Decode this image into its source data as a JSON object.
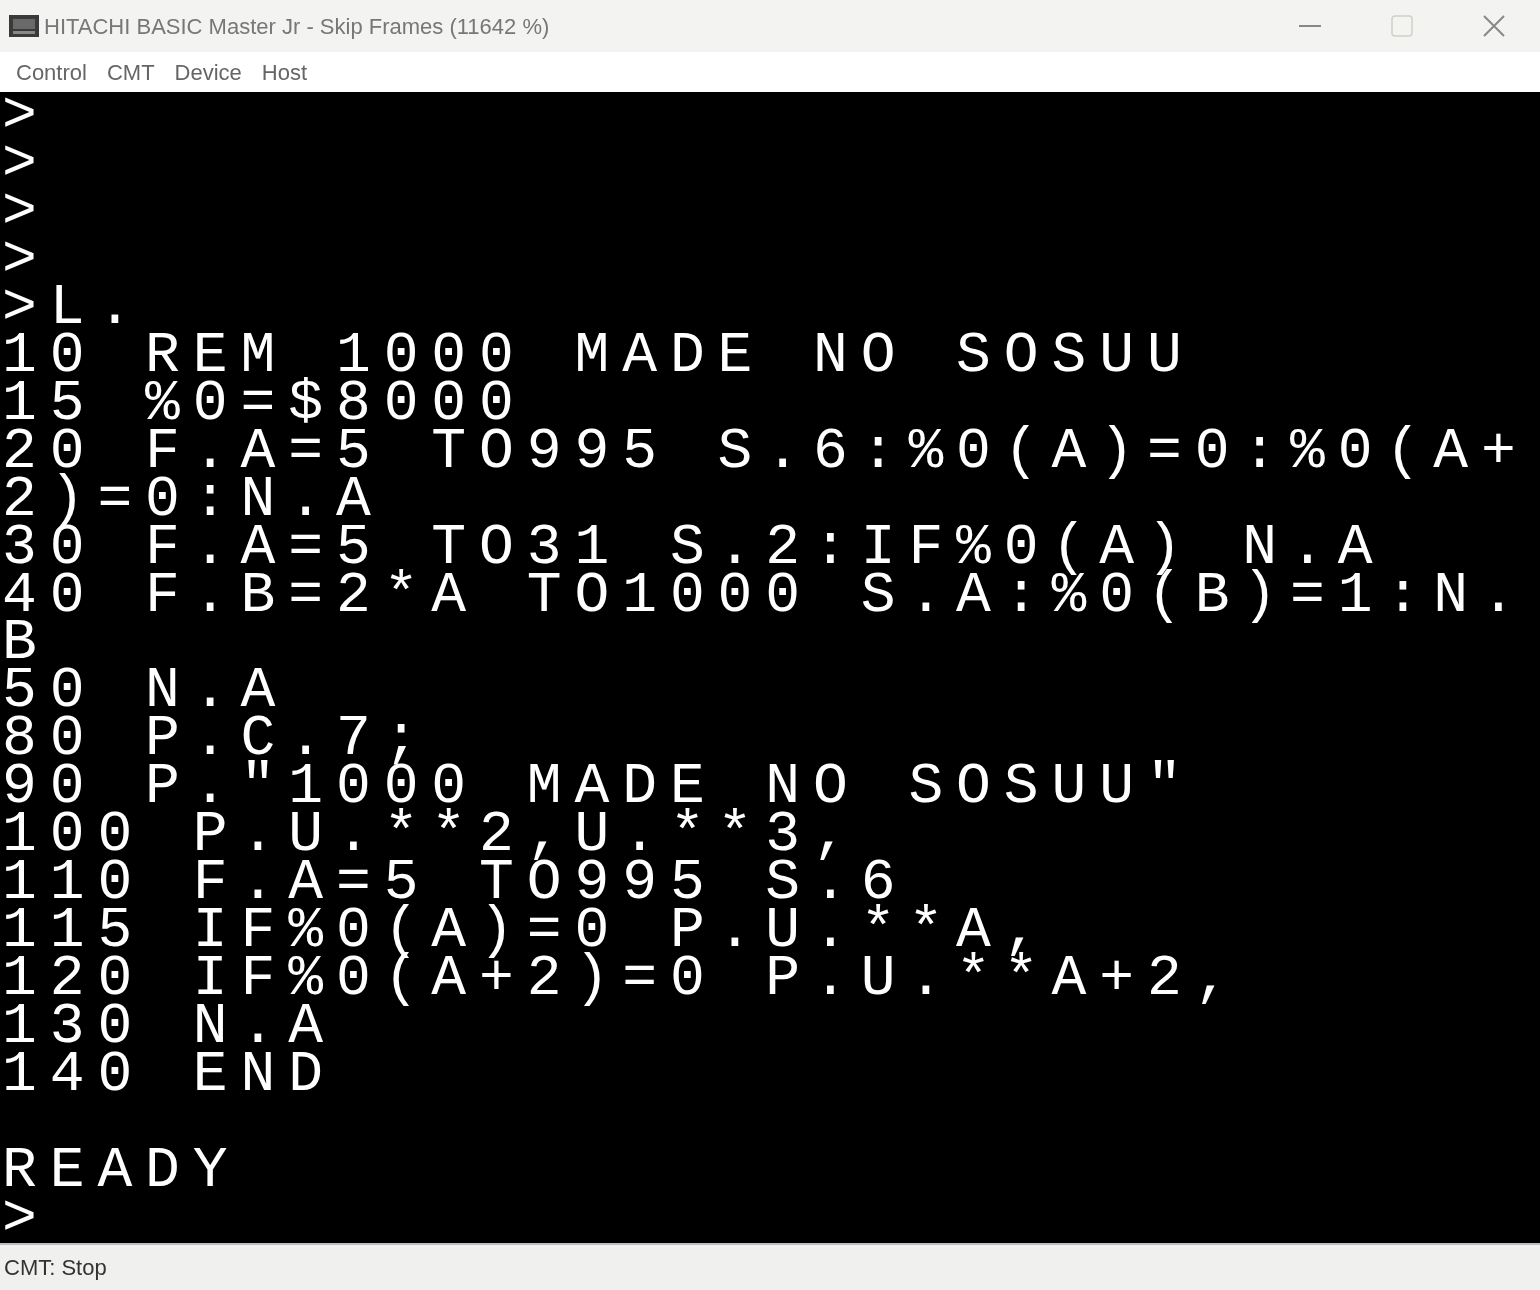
{
  "window": {
    "title": "HITACHI BASIC Master Jr - Skip Frames (11642 %)"
  },
  "menu": [
    "Control",
    "CMT",
    "Device",
    "Host"
  ],
  "screen": {
    "lines": [
      ">",
      ">",
      ">",
      ">",
      ">L.",
      "10 REM 1000 MADE NO SOSUU",
      "15 %0=$8000",
      "20 F.A=5 TO995 S.6:%0(A)=0:%0(A+",
      "2)=0:N.A",
      "30 F.A=5 TO31 S.2:IF%0(A) N.A",
      "40 F.B=2*A TO1000 S.A:%0(B)=1:N.",
      "B",
      "50 N.A",
      "80 P.C.7;",
      "90 P.\"1000 MADE NO SOSUU\"",
      "100 P.U.**2,U.**3,",
      "110 F.A=5 TO995 S.6",
      "115 IF%0(A)=0 P.U.**A,",
      "120 IF%0(A+2)=0 P.U.**A+2,",
      "130 N.A",
      "140 END"
    ],
    "lines_after_blank": [
      "READY",
      ">"
    ]
  },
  "status_bar": "CMT: Stop"
}
